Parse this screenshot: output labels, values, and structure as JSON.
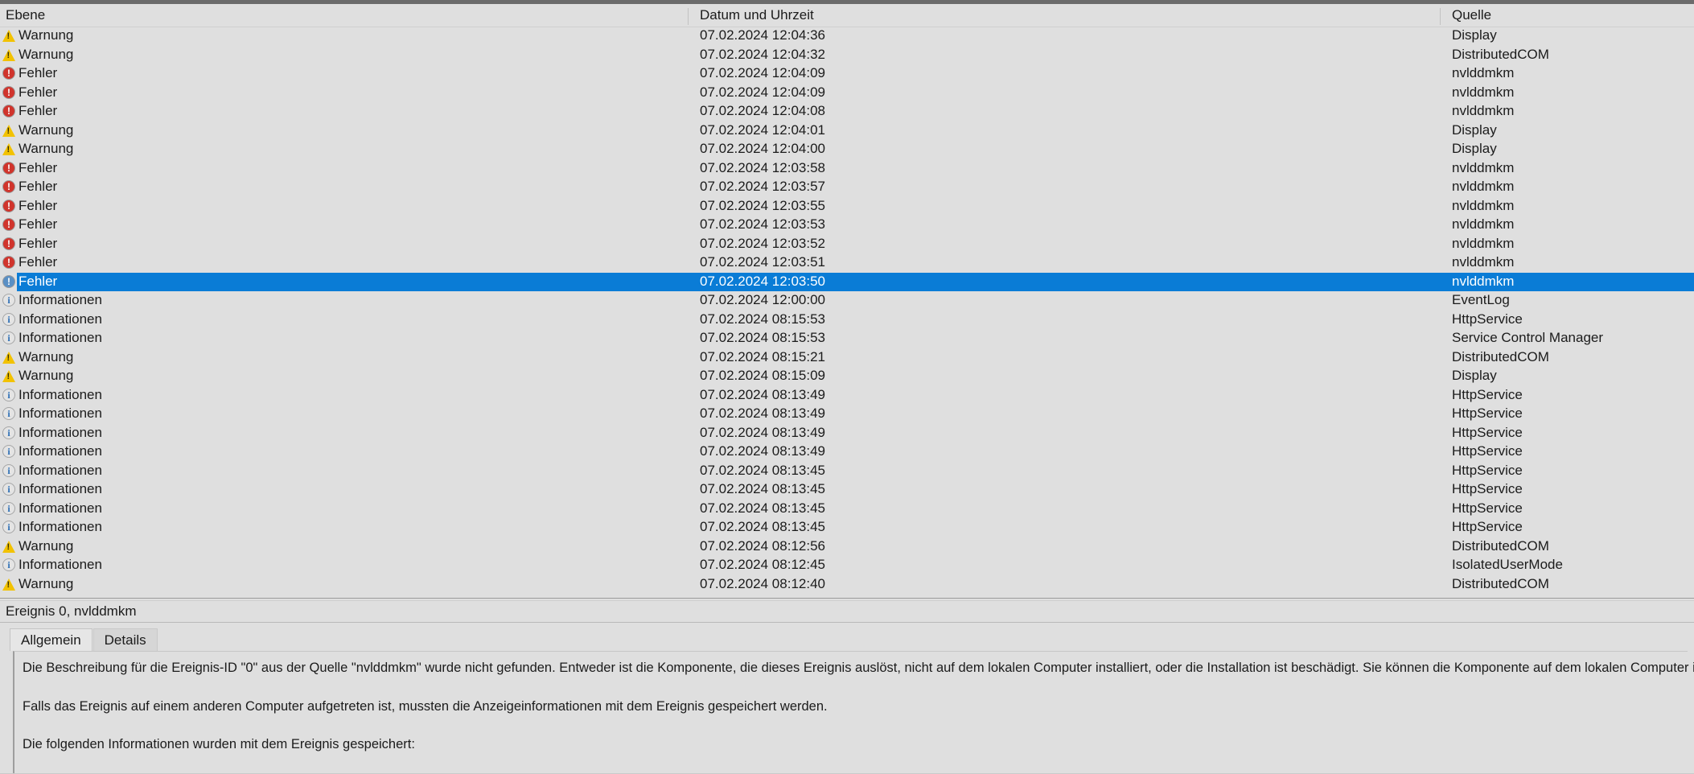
{
  "columns": {
    "level": "Ebene",
    "datetime": "Datum und Uhrzeit",
    "source": "Quelle"
  },
  "rows": [
    {
      "icon": "warning-icon",
      "level": "Warnung",
      "datetime": "07.02.2024 12:04:36",
      "source": "Display",
      "selected": false
    },
    {
      "icon": "warning-icon",
      "level": "Warnung",
      "datetime": "07.02.2024 12:04:32",
      "source": "DistributedCOM",
      "selected": false
    },
    {
      "icon": "error-icon",
      "level": "Fehler",
      "datetime": "07.02.2024 12:04:09",
      "source": "nvlddmkm",
      "selected": false
    },
    {
      "icon": "error-icon",
      "level": "Fehler",
      "datetime": "07.02.2024 12:04:09",
      "source": "nvlddmkm",
      "selected": false
    },
    {
      "icon": "error-icon",
      "level": "Fehler",
      "datetime": "07.02.2024 12:04:08",
      "source": "nvlddmkm",
      "selected": false
    },
    {
      "icon": "warning-icon",
      "level": "Warnung",
      "datetime": "07.02.2024 12:04:01",
      "source": "Display",
      "selected": false
    },
    {
      "icon": "warning-icon",
      "level": "Warnung",
      "datetime": "07.02.2024 12:04:00",
      "source": "Display",
      "selected": false
    },
    {
      "icon": "error-icon",
      "level": "Fehler",
      "datetime": "07.02.2024 12:03:58",
      "source": "nvlddmkm",
      "selected": false
    },
    {
      "icon": "error-icon",
      "level": "Fehler",
      "datetime": "07.02.2024 12:03:57",
      "source": "nvlddmkm",
      "selected": false
    },
    {
      "icon": "error-icon",
      "level": "Fehler",
      "datetime": "07.02.2024 12:03:55",
      "source": "nvlddmkm",
      "selected": false
    },
    {
      "icon": "error-icon",
      "level": "Fehler",
      "datetime": "07.02.2024 12:03:53",
      "source": "nvlddmkm",
      "selected": false
    },
    {
      "icon": "error-icon",
      "level": "Fehler",
      "datetime": "07.02.2024 12:03:52",
      "source": "nvlddmkm",
      "selected": false
    },
    {
      "icon": "error-icon",
      "level": "Fehler",
      "datetime": "07.02.2024 12:03:51",
      "source": "nvlddmkm",
      "selected": false
    },
    {
      "icon": "error-icon",
      "level": "Fehler",
      "datetime": "07.02.2024 12:03:50",
      "source": "nvlddmkm",
      "selected": true
    },
    {
      "icon": "information-icon",
      "level": "Informationen",
      "datetime": "07.02.2024 12:00:00",
      "source": "EventLog",
      "selected": false
    },
    {
      "icon": "information-icon",
      "level": "Informationen",
      "datetime": "07.02.2024 08:15:53",
      "source": "HttpService",
      "selected": false
    },
    {
      "icon": "information-icon",
      "level": "Informationen",
      "datetime": "07.02.2024 08:15:53",
      "source": "Service Control Manager",
      "selected": false
    },
    {
      "icon": "warning-icon",
      "level": "Warnung",
      "datetime": "07.02.2024 08:15:21",
      "source": "DistributedCOM",
      "selected": false
    },
    {
      "icon": "warning-icon",
      "level": "Warnung",
      "datetime": "07.02.2024 08:15:09",
      "source": "Display",
      "selected": false
    },
    {
      "icon": "information-icon",
      "level": "Informationen",
      "datetime": "07.02.2024 08:13:49",
      "source": "HttpService",
      "selected": false
    },
    {
      "icon": "information-icon",
      "level": "Informationen",
      "datetime": "07.02.2024 08:13:49",
      "source": "HttpService",
      "selected": false
    },
    {
      "icon": "information-icon",
      "level": "Informationen",
      "datetime": "07.02.2024 08:13:49",
      "source": "HttpService",
      "selected": false
    },
    {
      "icon": "information-icon",
      "level": "Informationen",
      "datetime": "07.02.2024 08:13:49",
      "source": "HttpService",
      "selected": false
    },
    {
      "icon": "information-icon",
      "level": "Informationen",
      "datetime": "07.02.2024 08:13:45",
      "source": "HttpService",
      "selected": false
    },
    {
      "icon": "information-icon",
      "level": "Informationen",
      "datetime": "07.02.2024 08:13:45",
      "source": "HttpService",
      "selected": false
    },
    {
      "icon": "information-icon",
      "level": "Informationen",
      "datetime": "07.02.2024 08:13:45",
      "source": "HttpService",
      "selected": false
    },
    {
      "icon": "information-icon",
      "level": "Informationen",
      "datetime": "07.02.2024 08:13:45",
      "source": "HttpService",
      "selected": false
    },
    {
      "icon": "warning-icon",
      "level": "Warnung",
      "datetime": "07.02.2024 08:12:56",
      "source": "DistributedCOM",
      "selected": false
    },
    {
      "icon": "information-icon",
      "level": "Informationen",
      "datetime": "07.02.2024 08:12:45",
      "source": "IsolatedUserMode",
      "selected": false
    },
    {
      "icon": "warning-icon",
      "level": "Warnung",
      "datetime": "07.02.2024 08:12:40",
      "source": "DistributedCOM",
      "selected": false
    }
  ],
  "detail": {
    "header": "Ereignis 0, nvlddmkm",
    "tabs": [
      {
        "label": "Allgemein",
        "active": true
      },
      {
        "label": "Details",
        "active": false
      }
    ],
    "paragraphs": [
      "Die Beschreibung für die Ereignis-ID \"0\" aus der Quelle \"nvlddmkm\" wurde nicht gefunden. Entweder ist die Komponente, die dieses Ereignis auslöst, nicht auf dem lokalen Computer installiert, oder die Installation ist beschädigt. Sie können die Komponente auf dem lokalen Computer installieren oder reparieren.",
      "Falls das Ereignis auf einem anderen Computer aufgetreten ist, mussten die Anzeigeinformationen mit dem Ereignis gespeichert werden.",
      "Die folgenden Informationen wurden mit dem Ereignis gespeichert:"
    ]
  },
  "colors": {
    "selection": "#0a7cd6",
    "background": "#dfdfdf",
    "warning": "#f2c200",
    "error": "#d0342c",
    "information": "#2d6fb5"
  }
}
